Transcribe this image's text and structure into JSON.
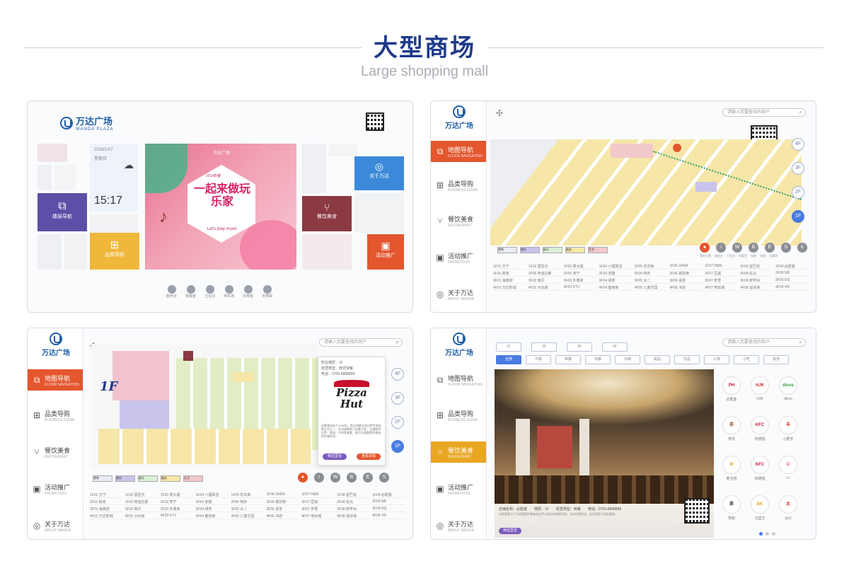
{
  "header": {
    "title": "大型商场",
    "subtitle": "Large shopping mall"
  },
  "colors": {
    "accent_blue": "#1f3a8a",
    "brand_blue": "#1f5fa8",
    "orange": "#e4572e",
    "gold": "#e8a623",
    "floor_active": "#4a7be0"
  },
  "logo": {
    "cn": "万达广场",
    "en": "WANDA PLAZA"
  },
  "panel1": {
    "date": "2019/1/07",
    "weekday": "星期日",
    "weather_icon": "cloud-icon",
    "time": "15:17",
    "poster_brand": "万达广场",
    "poster_headline": "一起来做玩乐家",
    "poster_tagline": "Let's play music",
    "poster_small": "2019新春",
    "tiles": {
      "nav": "楼层导航",
      "shops": "品类导购",
      "about": "关于万达",
      "food": "餐饮美食",
      "promo": "活动推广"
    },
    "bottom_icons": [
      "服务台",
      "母婴室",
      "卫生间",
      "停车场",
      "充电桩",
      "无障碍"
    ]
  },
  "sidebar": {
    "items": [
      {
        "cn": "地图导航",
        "en": "FLOOR NAVIGATION",
        "icon": "map-nav-icon"
      },
      {
        "cn": "品类导购",
        "en": "BUSINESS GUIDE",
        "icon": "category-icon"
      },
      {
        "cn": "餐饮美食",
        "en": "RESTAURANT",
        "icon": "fork-knife-icon"
      },
      {
        "cn": "活动推广",
        "en": "PROMOTION",
        "icon": "promo-icon"
      },
      {
        "cn": "关于万达",
        "en": "ABOUT WANDA",
        "icon": "about-icon"
      }
    ]
  },
  "search": {
    "placeholder": "请输入您要查找的商户"
  },
  "floors": [
    "4F",
    "3F",
    "2F",
    "1F"
  ],
  "panel2": {
    "legend": [
      "零售",
      "餐饮",
      "娱乐",
      "服务",
      "生活"
    ],
    "facilities": [
      "我的位置",
      "服务台",
      "卫生间",
      "母婴室",
      "电梯",
      "扶梯",
      "无障碍"
    ]
  },
  "panel3": {
    "floor_label": "1F",
    "popup": {
      "floor": "所在楼层：1F",
      "category": "经营类型：西式快餐",
      "phone": "电话：0755-8888888",
      "brand_line1": "Pizza",
      "brand_line2": "Hut",
      "desc": "必胜客创始于1958年，是全球最大的比萨专卖连锁企业之一，在全球拥有门店数千家，主要提供比萨、意面、牛排等美食，致力为顾客提供美味的用餐体验。",
      "btn_route": "到这里去",
      "btn_detail": "查看详情"
    },
    "legend": [
      "零售",
      "餐饮",
      "娱乐",
      "服务",
      "生活"
    ]
  },
  "panel4": {
    "floor_tabs": [
      "1F",
      "2F",
      "3F",
      "4F"
    ],
    "cat_tabs": [
      "全部",
      "中餐",
      "西餐",
      "快餐",
      "日韩",
      "甜品",
      "饮品",
      "火锅",
      "小吃",
      "其他"
    ],
    "info": {
      "name": "店铺名称：必胜客",
      "floor": "楼层：1F",
      "type": "经营类型：西餐",
      "phone": "电话：0755-8888888",
      "desc": "必胜客致力于为顾客提供美味的比萨与轻松的就餐环境，店内环境舒适，适合家庭与朋友聚餐。"
    },
    "btn": "到这里去",
    "brands": [
      {
        "name": "必胜客",
        "logo": "PH",
        "color": "#c8102e"
      },
      {
        "name": "HJK",
        "logo": "HJK",
        "color": "#d62f2f"
      },
      {
        "name": "dicos",
        "logo": "dicos",
        "color": "#2e9a3e"
      },
      {
        "name": "茶饮",
        "logo": "茶",
        "color": "#a0522d"
      },
      {
        "name": "肯德基",
        "logo": "KFC",
        "color": "#c8102e"
      },
      {
        "name": "小肥羊",
        "logo": "羊",
        "color": "#d62f2f"
      },
      {
        "name": "麦当劳",
        "logo": "M",
        "color": "#e8a623"
      },
      {
        "name": "肯德基",
        "logo": "KFC",
        "color": "#c8102e"
      },
      {
        "name": "U",
        "logo": "Ü",
        "color": "#e0457b"
      },
      {
        "name": "茶颜",
        "logo": "茶",
        "color": "#333333"
      },
      {
        "name": "汉堡王",
        "logo": "BK",
        "color": "#e8a623"
      },
      {
        "name": "太兴",
        "logo": "太",
        "color": "#d62f2f"
      }
    ]
  },
  "directory": [
    "1F01 万宁",
    "1F02 屈臣氏",
    "1F03 周大福",
    "1F04 六福珠宝",
    "1F05 优衣库",
    "1F06 ZARA",
    "1F07 H&M",
    "1F08 星巴克",
    "1F09 必胜客",
    "2F01 耐克",
    "2F02 阿迪达斯",
    "2F03 李宁",
    "2F04 安踏",
    "2F05 特步",
    "2F06 斯凯奇",
    "2F07 匡威",
    "2F08 彪马",
    "2F09 NB",
    "3F01 海底捞",
    "3F02 西贝",
    "3F03 外婆家",
    "3F04 绿茶",
    "3F05 太二",
    "3F06 喜茶",
    "3F07 奈雪",
    "3F08 鲜芋仙",
    "3F09 DQ",
    "4F01 万达影城",
    "4F02 大玩家",
    "4F03 KTV",
    "4F04 健身房",
    "4F05 儿童乐园",
    "4F06 书店",
    "4F07 电玩城",
    "4F08 溜冰场",
    "4F09 VR"
  ]
}
